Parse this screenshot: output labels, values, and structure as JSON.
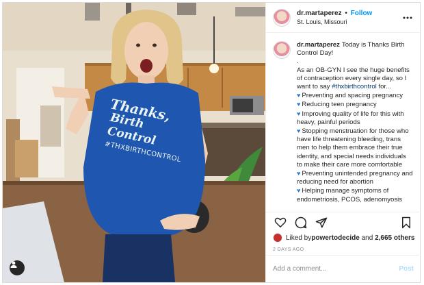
{
  "post": {
    "username": "dr.martaperez",
    "follow_label": "Follow",
    "location": "St. Louis, Missouri",
    "more_icon": "more-options-icon",
    "caption": {
      "lines": [
        "Today is Thanks Birth",
        "Control Day!",
        ".",
        "As an OB-GYN I see the huge benefits",
        "of contraception every single day, so I",
        "want to say "
      ],
      "hashtag": "#thxbirthcontrol",
      "hashtag_suffix": " for...",
      "bullets": [
        "Preventing and spacing pregnancy",
        "Reducing teen pregnancy",
        "Improving quality of life for this with heavy, painful periods",
        "Stopping menstruation for those who have life threatening bleeding, trans men to help them embrace their true identity, and special needs individuals to make their care more comfortable",
        "Preventing unintended pregnancy and reducing need for abortion",
        "Helping manage symptoms of endometriosis, PCOS, adenomyosis"
      ],
      "bullet_icon": "blue-heart-icon"
    },
    "likes": {
      "prefix": "Liked by ",
      "liker": "powertodecide",
      "connector": " and ",
      "others": "2,665 others"
    },
    "timestamp": "2 DAYS AGO",
    "comment_placeholder": "Add a comment...",
    "post_label": "Post",
    "shirt_text": {
      "line1": "Thanks,",
      "line2": "Birth Control",
      "line3": "#THXBIRTHCONTROL"
    },
    "colors": {
      "follow": "#0095f6",
      "hashtag": "#00376b",
      "heart": "#2a7ad6",
      "shirt": "#1e56b0",
      "post_disabled": "#b2dffc"
    }
  }
}
